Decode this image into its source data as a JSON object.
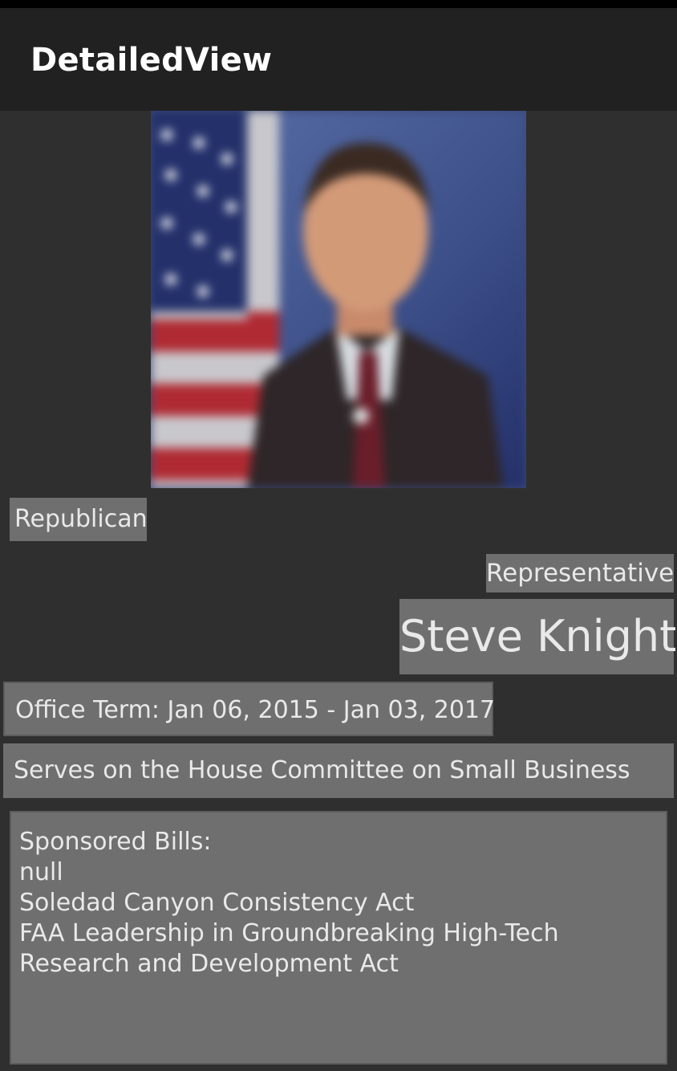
{
  "app_bar": {
    "title": "DetailedView"
  },
  "portrait": {
    "description_icon": "portrait-photo"
  },
  "details": {
    "party": "Republican",
    "role": "Representative",
    "name": "Steve Knight",
    "office_term": "Office Term: Jan 06, 2015 - Jan 03, 2017",
    "committee": "Serves on the House Committee on Small Business"
  },
  "bills": {
    "heading": "Sponsored Bills:",
    "items": [
      "null",
      "Soledad Canyon Consistency Act",
      "FAA Leadership in Groundbreaking High-Tech",
      "Research and Development Act"
    ]
  }
}
